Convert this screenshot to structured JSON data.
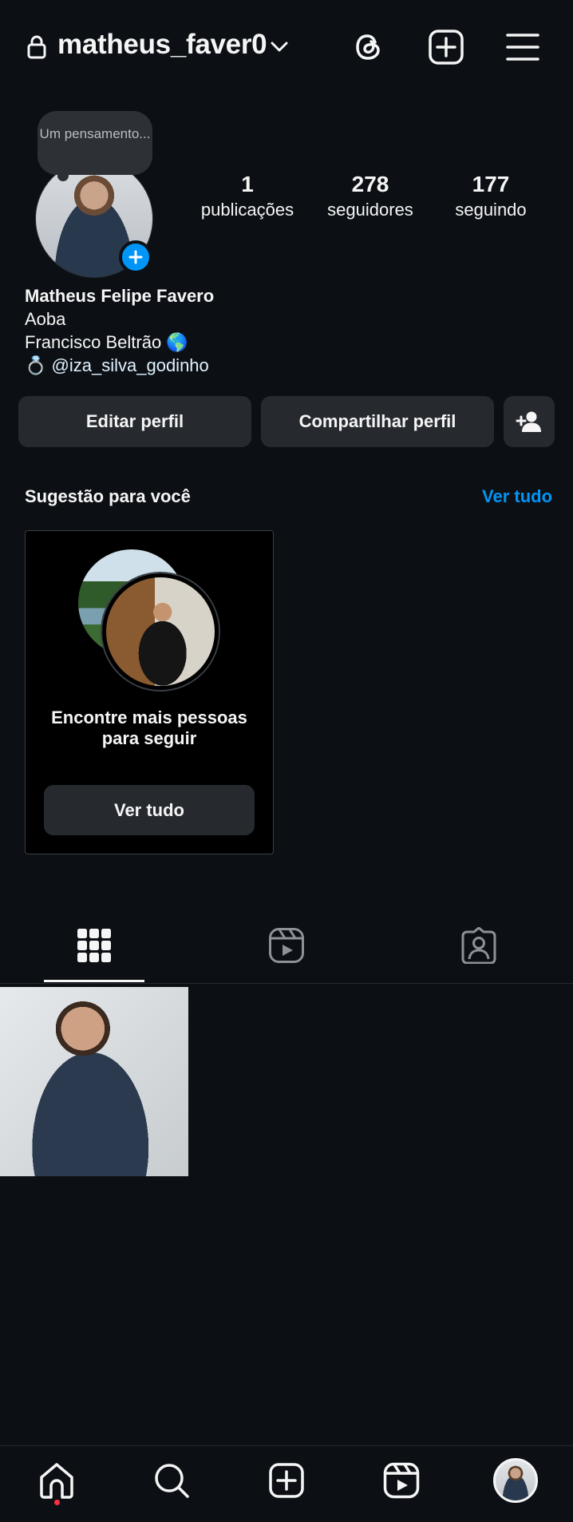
{
  "header": {
    "username": "matheus_faver0"
  },
  "profile": {
    "note": "Um pensamento...",
    "stats": {
      "posts": {
        "value": "1",
        "label": "publicações"
      },
      "followers": {
        "value": "278",
        "label": "seguidores"
      },
      "following": {
        "value": "177",
        "label": "seguindo"
      }
    },
    "bio": {
      "name": "Matheus Felipe Favero",
      "line1": "Aoba",
      "line2": "Francisco Beltrão 🌎",
      "emoji": "💍",
      "mention": "@iza_silva_godinho"
    }
  },
  "actions": {
    "edit_label": "Editar perfil",
    "share_label": "Compartilhar perfil"
  },
  "suggestions": {
    "title": "Sugestão para você",
    "see_all": "Ver tudo",
    "card_text": "Encontre mais pessoas para seguir",
    "card_button": "Ver tudo"
  },
  "colors": {
    "background": "#0c1014",
    "button": "#262a2f",
    "accent": "#0095f6",
    "notification": "#ff3040"
  },
  "icons": {
    "header": [
      "lock-icon",
      "chevron-down-icon",
      "threads-icon",
      "new-post-icon",
      "menu-icon"
    ],
    "tabs": [
      "grid-icon",
      "reels-icon",
      "tagged-icon"
    ],
    "nav": [
      "home-icon",
      "search-icon",
      "create-icon",
      "reels-icon",
      "profile-avatar"
    ]
  }
}
